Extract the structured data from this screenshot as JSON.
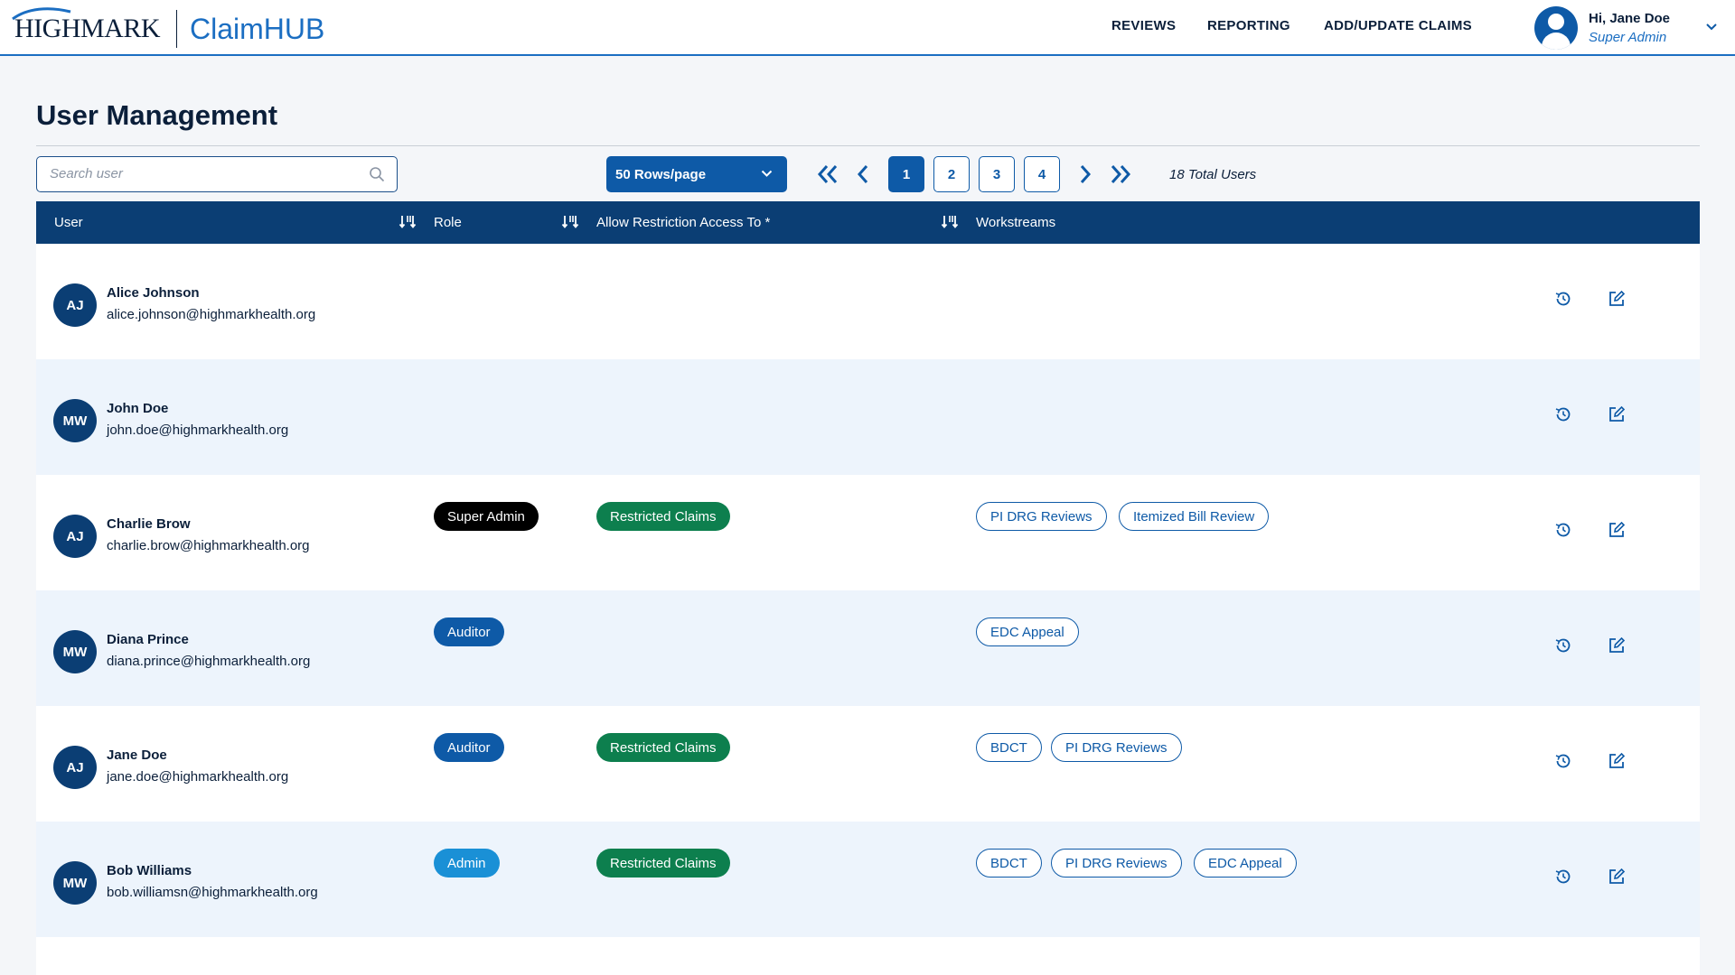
{
  "header": {
    "logo_text": "HIGHMARK",
    "app_name": "ClaimHUB",
    "nav": [
      {
        "label": "REVIEWS"
      },
      {
        "label": "REPORTING"
      },
      {
        "label": "ADD/UPDATE CLAIMS"
      }
    ],
    "user": {
      "greeting": "Hi, Jane Doe",
      "role": "Super Admin"
    }
  },
  "page": {
    "title": "User Management"
  },
  "toolbar": {
    "search_placeholder": "Search user",
    "rows_per_page": "50 Rows/page",
    "pages": [
      "1",
      "2",
      "3",
      "4"
    ],
    "active_page": "1",
    "total_users": "18 Total Users"
  },
  "table": {
    "columns": [
      "User",
      "Role",
      "Allow Restriction Access To *",
      "Workstreams"
    ],
    "rows": [
      {
        "initials": "AJ",
        "name": "Alice Johnson",
        "email": "alice.johnson@highmarkhealth.org",
        "role": "",
        "restriction": "",
        "workstreams": []
      },
      {
        "initials": "MW",
        "name": "John Doe",
        "email": "john.doe@highmarkhealth.org",
        "role": "",
        "restriction": "",
        "workstreams": []
      },
      {
        "initials": "AJ",
        "name": "Charlie Brow",
        "email": "charlie.brow@highmarkhealth.org",
        "role": "Super Admin",
        "restriction": "Restricted Claims",
        "workstreams": [
          "PI DRG Reviews",
          "Itemized Bill Review"
        ]
      },
      {
        "initials": "MW",
        "name": "Diana Prince",
        "email": "diana.prince@highmarkhealth.org",
        "role": "Auditor",
        "restriction": "",
        "workstreams": [
          "EDC Appeal"
        ]
      },
      {
        "initials": "AJ",
        "name": "Jane Doe",
        "email": "jane.doe@highmarkhealth.org",
        "role": "Auditor",
        "restriction": "Restricted Claims",
        "workstreams": [
          "BDCT",
          "PI DRG Reviews"
        ]
      },
      {
        "initials": "MW",
        "name": "Bob Williams",
        "email": "bob.williamsn@highmarkhealth.org",
        "role": "Admin",
        "restriction": "Restricted Claims",
        "workstreams": [
          "BDCT",
          "PI DRG Reviews",
          "EDC Appeal"
        ]
      }
    ]
  },
  "colors": {
    "navy": "#0b3e74",
    "primary_blue": "#0e5aa7",
    "admin_blue": "#1a90d6",
    "restricted_green": "#0d7f4e",
    "super_admin_black": "#000000",
    "row_alt": "#edf4fc"
  },
  "icons": {
    "search": "search-icon",
    "history": "history-icon",
    "edit": "edit-icon",
    "sort": "sort-icon",
    "first": "double-chevron-left-icon",
    "prev": "chevron-left-icon",
    "next": "chevron-right-icon",
    "last": "double-chevron-right-icon"
  }
}
